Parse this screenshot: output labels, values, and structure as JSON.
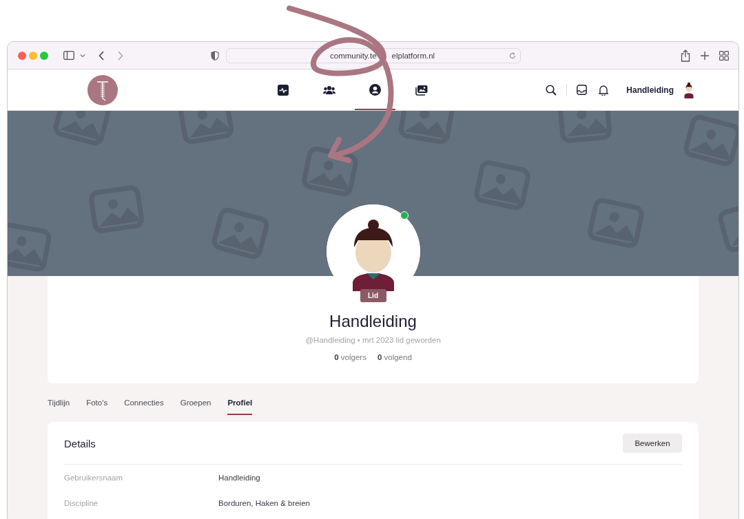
{
  "browser": {
    "url_start": "community.te",
    "url_end": "elplatform.nl"
  },
  "nav": {
    "tabs": [
      {
        "kind": "activity",
        "selected": false
      },
      {
        "kind": "people",
        "selected": false
      },
      {
        "kind": "profile",
        "selected": true
      },
      {
        "kind": "photos",
        "selected": false
      }
    ],
    "user_name": "Handleiding"
  },
  "profile": {
    "online": true,
    "badge": "Lid",
    "name": "Handleiding",
    "subtitle": "@Handleiding • mrt 2023 lid geworden",
    "followers": "**0** volgers",
    "following": "**0** volgend"
  },
  "tabs": [
    {
      "label": "Tijdlijn",
      "selected": false
    },
    {
      "label": "Foto's",
      "selected": false
    },
    {
      "label": "Connecties",
      "selected": false
    },
    {
      "label": "Groepen",
      "selected": false
    },
    {
      "label": "Profiel",
      "selected": true
    }
  ],
  "details": {
    "title": "Details",
    "edit_button": "Bewerken",
    "fields": [
      {
        "label": "Gebruikersnaam",
        "value": "Handleiding"
      },
      {
        "label": "Discipline",
        "value": "Borduren, Haken & breien"
      }
    ]
  }
}
